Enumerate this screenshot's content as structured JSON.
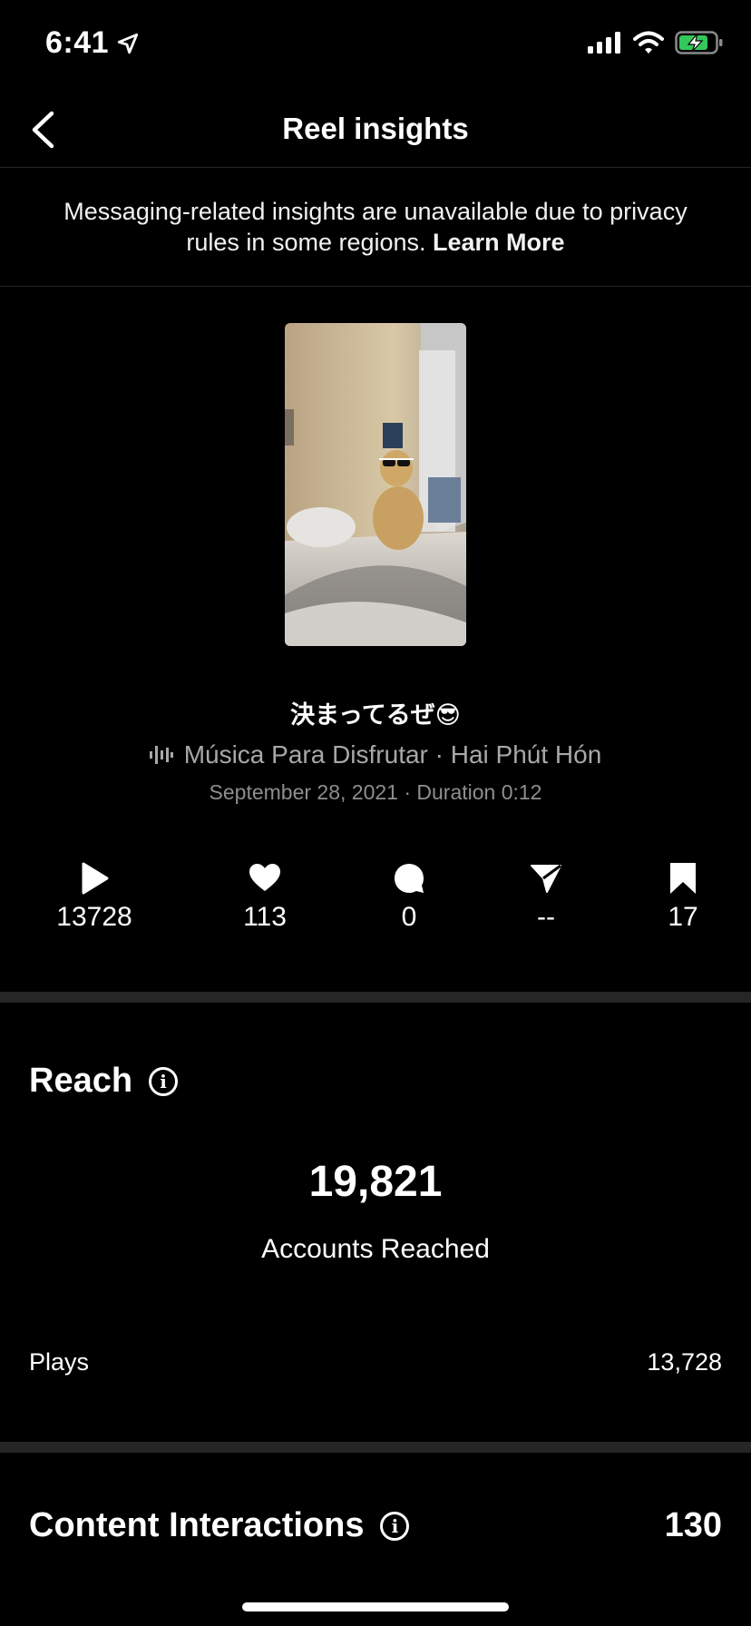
{
  "status_bar": {
    "time": "6:41"
  },
  "header": {
    "title": "Reel insights"
  },
  "notice": {
    "text": "Messaging-related insights are unavailable due to privacy rules in some regions. ",
    "link": "Learn More"
  },
  "reel": {
    "caption": "決まってるぜ😎",
    "music": "Música Para Disfrutar · Hai Phút Hón",
    "meta": "September 28, 2021 · Duration 0:12"
  },
  "stats": {
    "plays": "13728",
    "likes": "113",
    "comments": "0",
    "shares": "--",
    "saves": "17"
  },
  "reach": {
    "title": "Reach",
    "accounts_reached": "19,821",
    "accounts_reached_label": "Accounts Reached",
    "plays_label": "Plays",
    "plays_value": "13,728"
  },
  "content_interactions": {
    "title": "Content Interactions",
    "value": "130"
  },
  "colors": {
    "background": "#000000",
    "divider": "#262626",
    "battery": "#34c759"
  }
}
